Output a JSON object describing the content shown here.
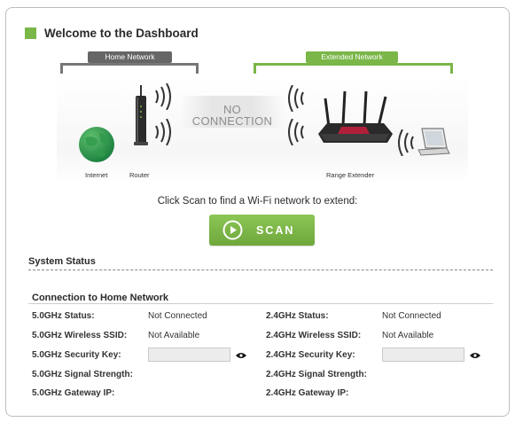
{
  "dashboard": {
    "title": "Welcome to the Dashboard"
  },
  "diagram": {
    "home_network_label": "Home Network",
    "extended_network_label": "Extended Network",
    "no_connection_line1": "NO",
    "no_connection_line2": "CONNECTION",
    "internet_caption": "Internet",
    "router_caption": "Router",
    "extender_caption": "Range Extender"
  },
  "scan": {
    "prompt": "Click Scan to find a Wi-Fi network to extend:",
    "button_label": "SCAN"
  },
  "system_status": {
    "title": "System Status"
  },
  "connection": {
    "title": "Connection to Home Network",
    "g5": {
      "status_label": "5.0GHz Status:",
      "status_value": "Not Connected",
      "ssid_label": "5.0GHz Wireless SSID:",
      "ssid_value": "Not Available",
      "key_label": "5.0GHz Security Key:",
      "key_value": "",
      "strength_label": "5.0GHz Signal Strength:",
      "gateway_label": "5.0GHz Gateway IP:"
    },
    "g24": {
      "status_label": "2.4GHz Status:",
      "status_value": "Not Connected",
      "ssid_label": "2.4GHz Wireless SSID:",
      "ssid_value": "Not Available",
      "key_label": "2.4GHz Security Key:",
      "key_value": "",
      "strength_label": "2.4GHz Signal Strength:",
      "gateway_label": "2.4GHz Gateway IP:"
    }
  },
  "colors": {
    "accent_green": "#7ab648",
    "home_gray": "#666666"
  },
  "icons": [
    "globe-icon",
    "router-icon",
    "extender-icon",
    "laptop-icon",
    "play-icon",
    "eye-icon"
  ]
}
